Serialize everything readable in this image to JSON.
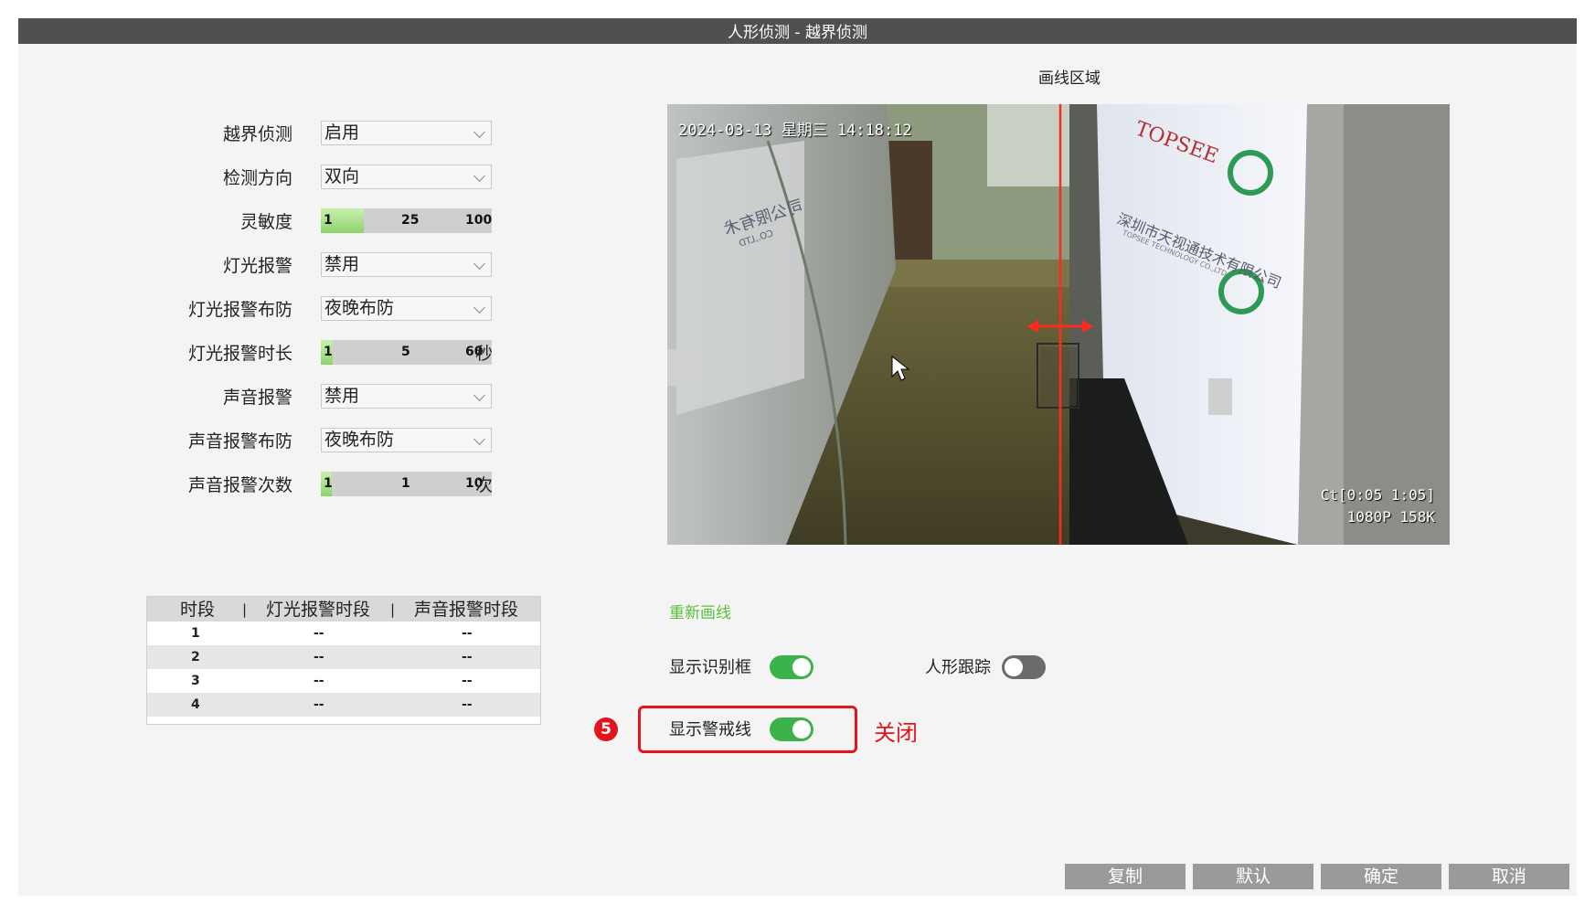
{
  "window": {
    "title": "人形侦测 - 越界侦测"
  },
  "settings": [
    {
      "type": "select",
      "label": "越界侦测",
      "value": "启用"
    },
    {
      "type": "select",
      "label": "检测方向",
      "value": "双向"
    },
    {
      "type": "slider",
      "label": "灵敏度",
      "min": "1",
      "value": "25",
      "max": "100",
      "unit": "",
      "fraction": 0.25
    },
    {
      "type": "select",
      "label": "灯光报警",
      "value": "禁用"
    },
    {
      "type": "select",
      "label": "灯光报警布防",
      "value": "夜晚布防"
    },
    {
      "type": "slider",
      "label": "灯光报警时长",
      "min": "1",
      "value": "5",
      "max": "60",
      "unit": "秒",
      "fraction": 0.07
    },
    {
      "type": "select",
      "label": "声音报警",
      "value": "禁用"
    },
    {
      "type": "select",
      "label": "声音报警布防",
      "value": "夜晚布防"
    },
    {
      "type": "slider",
      "label": "声音报警次数",
      "min": "1",
      "value": "1",
      "max": "10",
      "unit": "次",
      "fraction": 0.0
    }
  ],
  "schedule": {
    "headers": [
      "时段",
      "|",
      "灯光报警时段",
      "|",
      "声音报警时段"
    ],
    "rows": [
      [
        "1",
        "--",
        "--"
      ],
      [
        "2",
        "--",
        "--"
      ],
      [
        "3",
        "--",
        "--"
      ],
      [
        "4",
        "--",
        "--"
      ]
    ]
  },
  "video": {
    "section_title": "画线区域",
    "osd_datetime": "2024-03-13 星期三 14:18:12",
    "osd_ct": "Ct[0:05 1:05]",
    "osd_res": "1080P 158K",
    "sign_brand": "TOPSEE",
    "sign_company": "深圳市天视通技术有限公司",
    "sign_company_en": "TOPSEE TECHNOLOGY CO.,LTD",
    "sign_reversed": "司公限有术",
    "sign_reversed_en": "CO.,LTD"
  },
  "controls": {
    "redraw_link": "重新画线",
    "show_frame_label": "显示识别框",
    "show_frame_on": true,
    "human_track_label": "人形跟踪",
    "human_track_on": false,
    "show_line_label": "显示警戒线",
    "show_line_on": true
  },
  "annotation": {
    "step_number": "5",
    "note": "关闭",
    "color": "#e3141b"
  },
  "buttons": {
    "copy": "复制",
    "default": "默认",
    "ok": "确定",
    "cancel": "取消"
  },
  "colors": {
    "accent_green": "#3cb34a",
    "link_green": "#56c13a",
    "annotation_red": "#e3141b"
  }
}
